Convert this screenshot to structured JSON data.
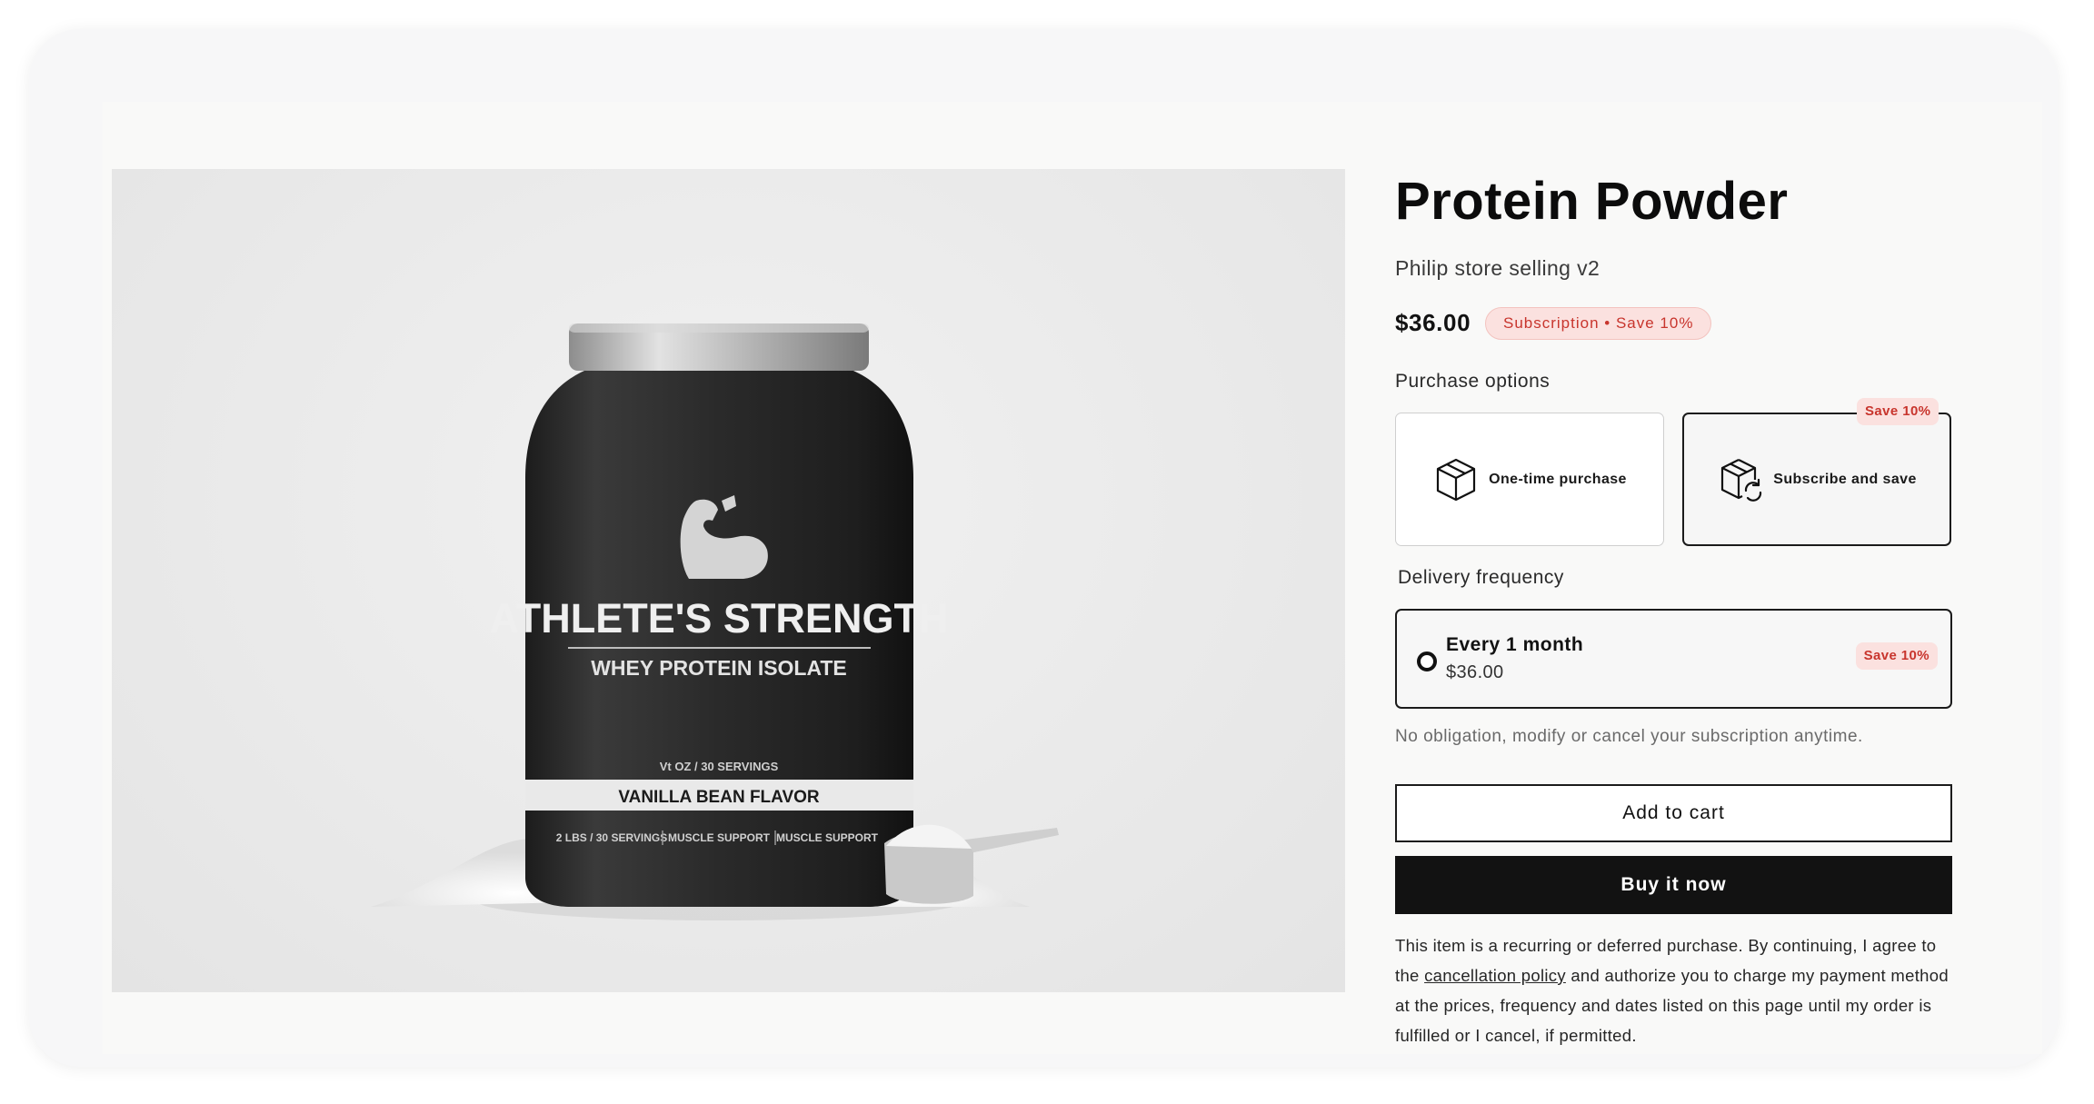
{
  "product": {
    "title": "Protein Powder",
    "vendor": "Philip store selling v2",
    "price": "$36.00",
    "subscription_badge": "Subscription • Save 10%"
  },
  "product_image": {
    "alt": "ATHLETE'S STRENGTH whey protein isolate jar",
    "jar_brand": "ATHLETE'S STRENGTH",
    "jar_subtitle": "WHEY PROTEIN ISOLATE",
    "jar_small": "Vt OZ / 30 SERVINGS",
    "jar_flavor": "VANILLA BEAN FLAVOR",
    "jar_footer": [
      "2 LBS / 30 SERVINGS",
      "MUSCLE SUPPORT",
      "MUSCLE SUPPORT"
    ]
  },
  "purchase_options": {
    "label": "Purchase options",
    "options": [
      {
        "label": "One-time purchase",
        "icon": "box-icon",
        "selected": false
      },
      {
        "label": "Subscribe and save",
        "icon": "box-refresh-icon",
        "selected": true,
        "tag": "Save 10%"
      }
    ]
  },
  "delivery": {
    "label": "Delivery frequency",
    "option": {
      "name": "Every 1 month",
      "price": "$36.00",
      "tag": "Save 10%"
    }
  },
  "note": "No obligation, modify or cancel your subscription anytime.",
  "buttons": {
    "add_to_cart": "Add to cart",
    "buy_now": "Buy it now"
  },
  "legal": {
    "before": "This item is a recurring or deferred purchase. By continuing, I agree to the ",
    "link": "cancellation policy",
    "after": " and authorize you to charge my payment method at the prices, frequency and dates listed on this page until my order is fulfilled or I cancel, if permitted."
  },
  "colors": {
    "accent_badge_bg": "#fbe1df",
    "accent_badge_text": "#c8352d",
    "primary_button": "#121212"
  }
}
